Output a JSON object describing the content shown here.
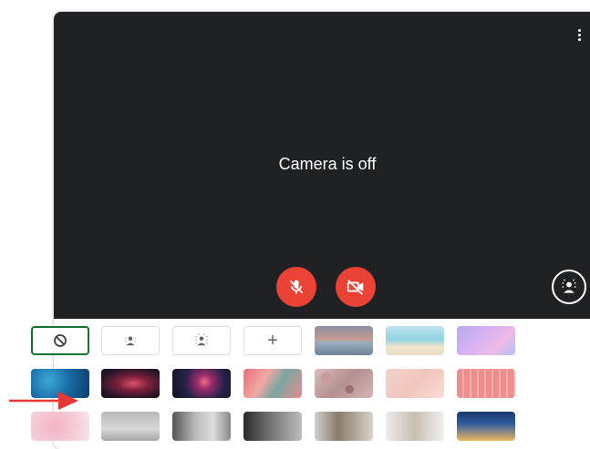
{
  "preview": {
    "status_text": "Camera is off",
    "mic_icon": "mic-off-icon",
    "camera_icon": "videocam-off-icon",
    "effects_icon": "person-blur-icon",
    "menu_icon": "more-vert-icon"
  },
  "colors": {
    "video_bg": "#202124",
    "control_red": "#ea4335",
    "selected_green": "#137333",
    "arrow_red": "#e53935"
  },
  "background_options": [
    {
      "name": "no-effect",
      "icon": "block-icon",
      "selected": true
    },
    {
      "name": "slight-blur",
      "icon": "blur-person-icon"
    },
    {
      "name": "blur",
      "icon": "blur-person-strong-icon"
    },
    {
      "name": "upload",
      "icon": "plus-icon",
      "label": "+"
    }
  ],
  "background_images": [
    "sunset-beach",
    "tropical-sea",
    "purple-clouds",
    "underwater-blue",
    "pink-nebula",
    "fireworks",
    "cherry-blossom-branch",
    "pink-petals",
    "peach-blush",
    "pink-pattern",
    "pink-flowers",
    "gray-room",
    "light-interior",
    "dark-interior",
    "bookshelf",
    "white-interior",
    "night-city"
  ]
}
